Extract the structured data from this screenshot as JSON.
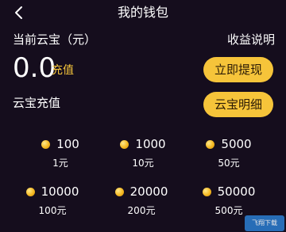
{
  "nav": {
    "title": "我的钱包"
  },
  "balance": {
    "label": "当前云宝（元）",
    "value": "0.0",
    "recharge_label": "充值",
    "income_link": "收益说明"
  },
  "buttons": {
    "withdraw": "立即提现",
    "detail": "云宝明细"
  },
  "section": {
    "recharge_title": "云宝充值"
  },
  "packages": [
    {
      "coins": "100",
      "price": "1元"
    },
    {
      "coins": "1000",
      "price": "10元"
    },
    {
      "coins": "5000",
      "price": "50元"
    },
    {
      "coins": "10000",
      "price": "100元"
    },
    {
      "coins": "20000",
      "price": "200元"
    },
    {
      "coins": "50000",
      "price": "500元"
    }
  ],
  "watermark": "飞翔下载",
  "colors": {
    "background": "#150d1d",
    "accent": "#f6c43a",
    "recharge_text": "#f7c63b"
  },
  "icons": {
    "back": "chevron-left-icon",
    "coin": "gold-coin-icon"
  }
}
